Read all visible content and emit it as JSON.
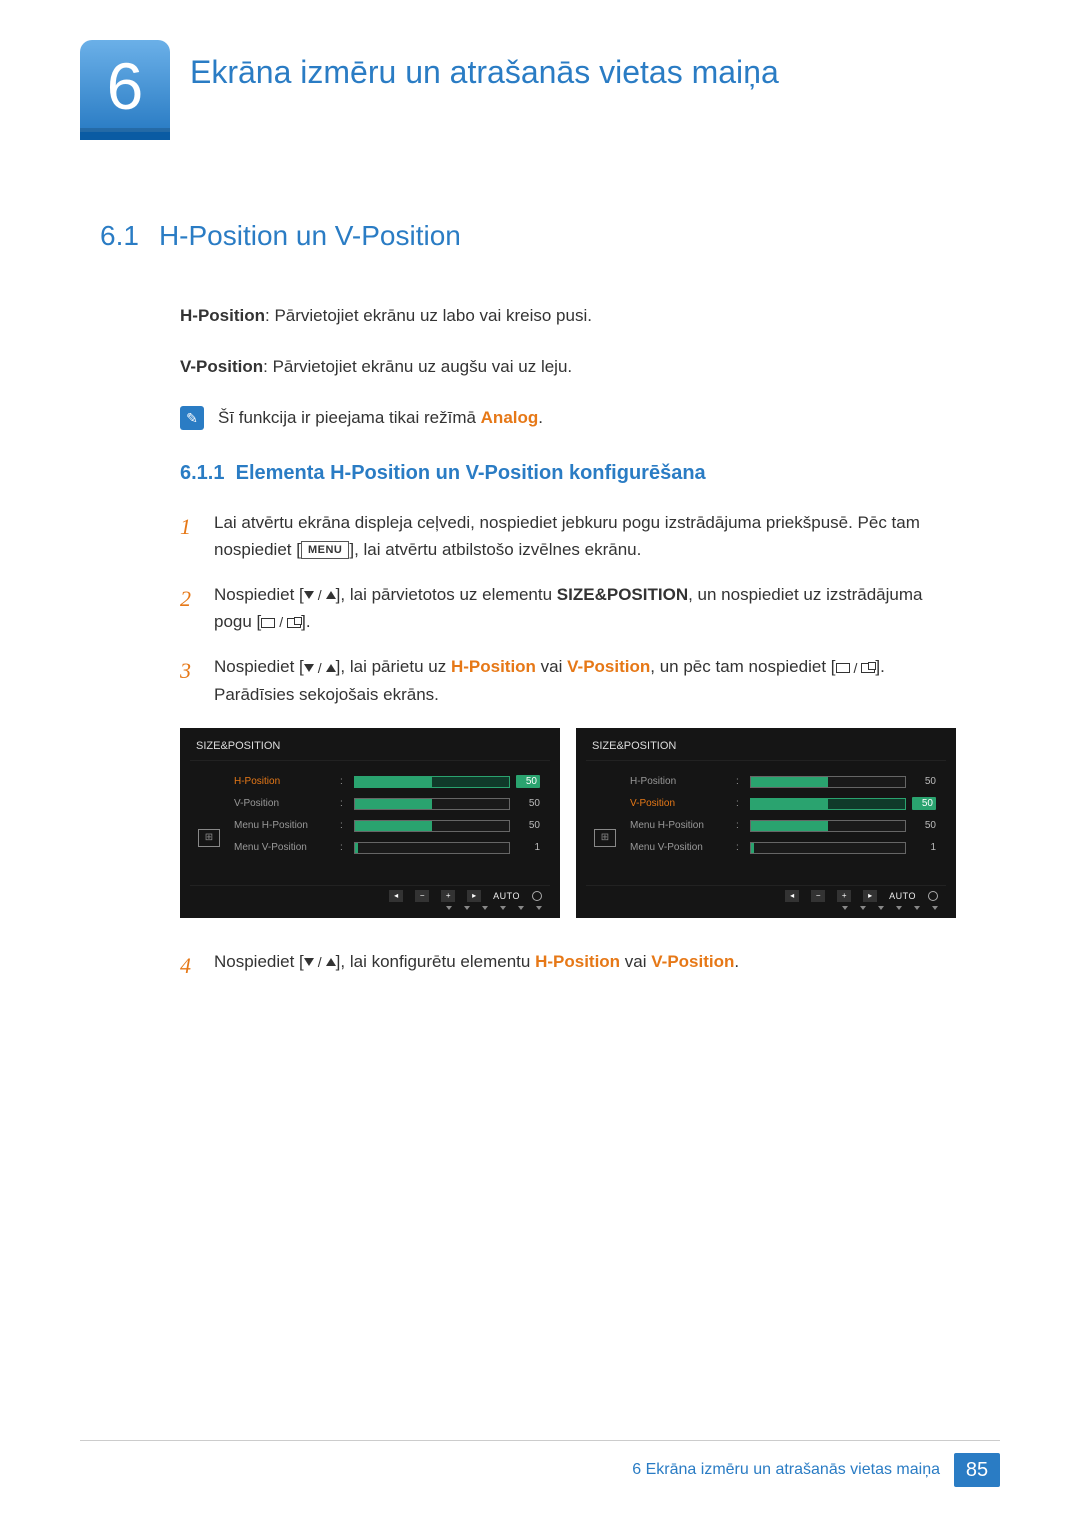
{
  "chapter": {
    "number": "6",
    "title": "Ekrāna izmēru un atrašanās vietas maiņa"
  },
  "section": {
    "number": "6.1",
    "title": "H-Position un V-Position"
  },
  "hpos_label": "H-Position",
  "hpos_desc": ": Pārvietojiet ekrānu uz labo vai kreiso pusi.",
  "vpos_label": "V-Position",
  "vpos_desc": ": Pārvietojiet ekrānu uz augšu vai uz leju.",
  "note_prefix": "Šī funkcija ir pieejama tikai režīmā ",
  "note_mode": "Analog",
  "note_suffix": ".",
  "subsection": {
    "number": "6.1.1",
    "title": "Elementa H-Position un V-Position konfigurēšana"
  },
  "steps": {
    "s1a": "Lai atvērtu ekrāna displeja ceļvedi, nospiediet jebkuru pogu izstrādājuma priekšpusē. Pēc tam nospiediet [",
    "s1_key": "MENU",
    "s1b": "], lai atvērtu atbilstošo izvēlnes ekrānu.",
    "s2a": "Nospiediet [",
    "s2b": "], lai pārvietotos uz elementu ",
    "s2_target": "SIZE&POSITION",
    "s2c": ", un nospiediet uz izstrādājuma pogu [",
    "s2d": "].",
    "s3a": "Nospiediet [",
    "s3b": "], lai pārietu uz ",
    "s3_h": "H-Position",
    "s3_or": " vai ",
    "s3_v": "V-Position",
    "s3c": ", un pēc tam nospiediet [",
    "s3d": "]. Parādīsies sekojošais ekrāns.",
    "s4a": "Nospiediet [",
    "s4b": "], lai konfigurētu elementu ",
    "s4_h": "H-Position",
    "s4_or": " vai ",
    "s4_v": "V-Position",
    "s4c": "."
  },
  "osd": {
    "title": "SIZE&POSITION",
    "items": [
      {
        "label": "H-Position",
        "value": "50",
        "fill": 50
      },
      {
        "label": "V-Position",
        "value": "50",
        "fill": 50
      },
      {
        "label": "Menu H-Position",
        "value": "50",
        "fill": 50
      },
      {
        "label": "Menu V-Position",
        "value": "1",
        "fill": 2
      }
    ],
    "auto": "AUTO"
  },
  "footer": {
    "text": "6 Ekrāna izmēru un atrašanās vietas maiņa",
    "page": "85"
  }
}
